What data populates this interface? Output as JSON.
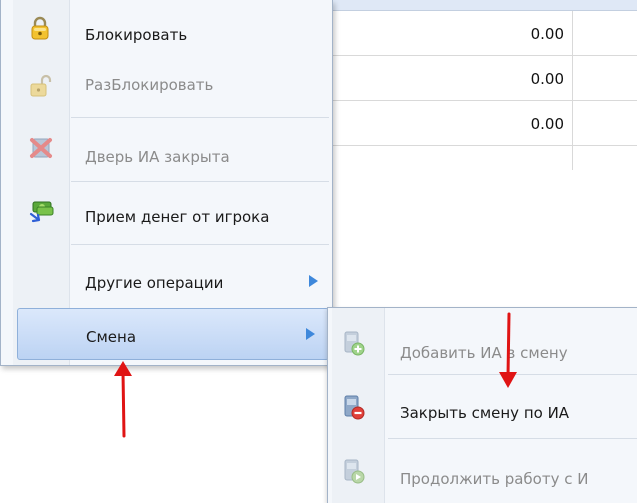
{
  "grid": {
    "rows": [
      {
        "value": "0.00"
      },
      {
        "value": "0.00"
      },
      {
        "value": "0.00"
      }
    ]
  },
  "menu": {
    "items": [
      {
        "label": "Блокировать",
        "icon": "lock-icon",
        "disabled": false
      },
      {
        "label": "РазБлокировать",
        "icon": "unlock-icon",
        "disabled": true
      },
      {
        "label": "Дверь ИА закрыта",
        "icon": "door-closed-icon",
        "disabled": true
      },
      {
        "label": "Прием денег от игрока",
        "icon": "money-icon",
        "disabled": false
      },
      {
        "label": "Другие операции",
        "icon": "",
        "disabled": false,
        "has_submenu": true
      },
      {
        "label": "Смена",
        "icon": "",
        "disabled": false,
        "has_submenu": true,
        "active": true
      }
    ]
  },
  "submenu": {
    "items": [
      {
        "label": "Добавить ИА в смену",
        "icon": "add-machine-icon",
        "disabled": true
      },
      {
        "label": "Закрыть смену по ИА",
        "icon": "close-shift-icon",
        "disabled": false
      },
      {
        "label": "Продолжить работу с И",
        "icon": "continue-work-icon",
        "disabled": true
      }
    ]
  },
  "colors": {
    "accent": "#3e88db",
    "annotation": "#e01414",
    "menu_bg": "#f4f7fb",
    "highlight": "#bcd3f3"
  }
}
